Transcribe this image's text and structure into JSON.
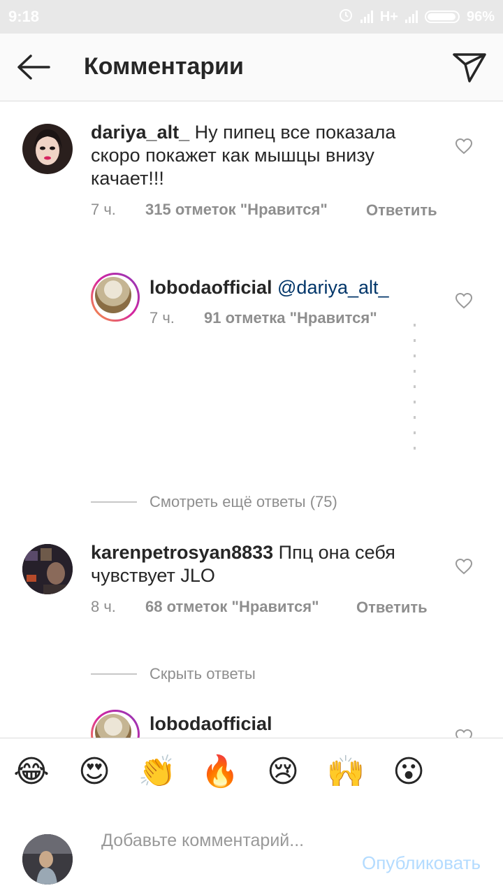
{
  "status_bar": {
    "time": "9:18",
    "network": "H+",
    "battery": "96%"
  },
  "header": {
    "title": "Комментарии",
    "back_icon": "arrow-left-icon",
    "send_icon": "paper-plane-icon"
  },
  "comments": [
    {
      "username": "dariya_alt_",
      "text": "Ну пипец все показала скоро покажет как мышцы внизу качает!!!",
      "time": "7 ч.",
      "likes": "315 отметок \"Нравится\"",
      "reply": "Ответить"
    },
    {
      "username": "lobodaofficial",
      "mention": "@dariya_alt_",
      "text": "",
      "time": "7 ч.",
      "likes": "91 отметка \"Нравится\""
    },
    {
      "username": "karenpetrosyan8833",
      "text": "Ппц она себя чувствует JLO",
      "time": "8 ч.",
      "likes": "68 отметок \"Нравится\"",
      "reply": "Ответить"
    },
    {
      "username": "lobodaofficial"
    }
  ],
  "view_more_replies": "Смотреть ещё ответы (75)",
  "hide_replies": "Скрыть ответы",
  "emoji_bar": [
    "😂",
    "😍",
    "👏",
    "🔥",
    "😢",
    "🙌",
    "😮"
  ],
  "input": {
    "placeholder": "Добавьте комментарий...",
    "publish": "Опубликовать"
  },
  "colors": {
    "link": "#003569",
    "muted": "#8e8e8e",
    "publish_disabled": "#b3dbff"
  }
}
